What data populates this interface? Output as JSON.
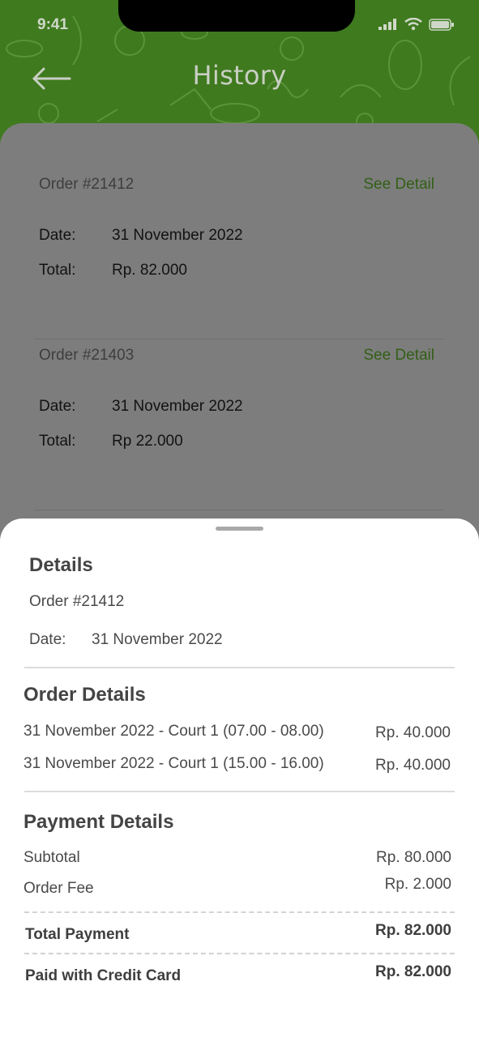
{
  "status_bar": {
    "time": "9:41"
  },
  "header": {
    "title": "History",
    "accent_color": "#4f8f24"
  },
  "orders": [
    {
      "id": "Order #21412",
      "link": "See Detail",
      "date_label": "Date:",
      "date": "31 November 2022",
      "total_label": "Total:",
      "total": "Rp. 82.000"
    },
    {
      "id": "Order #21403",
      "link": "See Detail",
      "date_label": "Date:",
      "date": "31 November 2022",
      "total_label": "Total:",
      "total": "Rp 22.000"
    }
  ],
  "sheet": {
    "title": "Details",
    "order_id": "Order #21412",
    "date_label": "Date:",
    "date": "31 November 2022",
    "order_details": {
      "title": "Order Details",
      "items": [
        {
          "desc": "31 November 2022 - Court 1 (07.00 - 08.00)",
          "price": "Rp. 40.000"
        },
        {
          "desc": "31 November 2022 - Court 1 (15.00 - 16.00)",
          "price": "Rp. 40.000"
        }
      ]
    },
    "payment_details": {
      "title": "Payment Details",
      "subtotal_label": "Subtotal",
      "subtotal": "Rp. 80.000",
      "fee_label": "Order Fee",
      "fee": "Rp. 2.000",
      "total_label": "Total Payment",
      "total": "Rp. 82.000",
      "paid_label": "Paid with Credit Card",
      "paid": "Rp. 82.000"
    }
  }
}
